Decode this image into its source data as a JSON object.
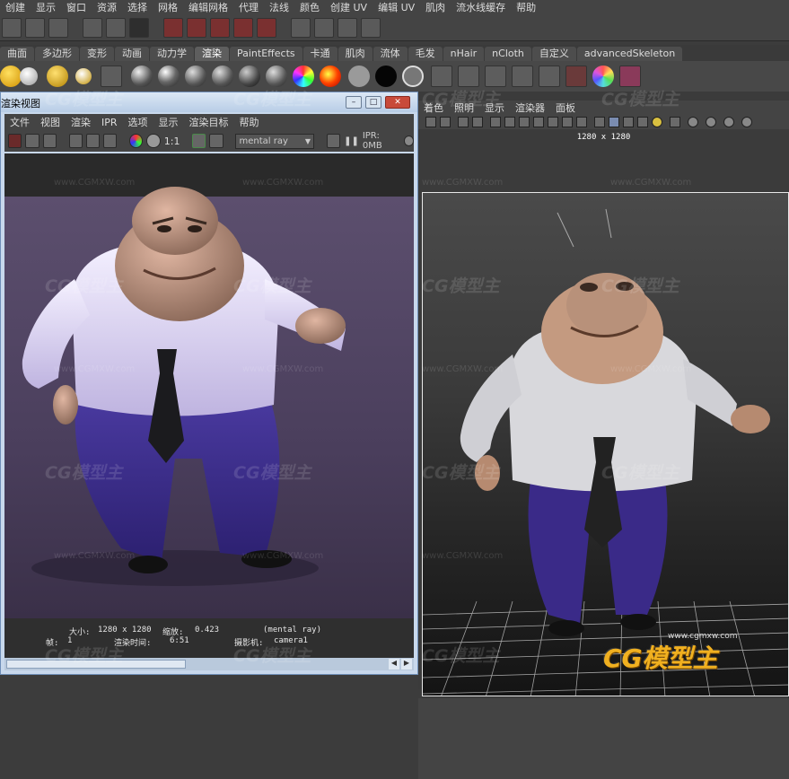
{
  "main_menu": [
    "创建",
    "显示",
    "窗口",
    "资源",
    "选择",
    "网格",
    "编辑网格",
    "代理",
    "法线",
    "颜色",
    "创建 UV",
    "编辑 UV",
    "肌肉",
    "流水线缓存",
    "帮助"
  ],
  "shelf_tabs": [
    "曲面",
    "多边形",
    "变形",
    "动画",
    "动力学",
    "渲染",
    "PaintEffects",
    "卡通",
    "肌肉",
    "流体",
    "毛发",
    "nHair",
    "nCloth",
    "自定义",
    "advancedSkeleton"
  ],
  "shelf_active_tab": "渲染",
  "render_view": {
    "title": "渲染视图",
    "menu": [
      "文件",
      "视图",
      "渲染",
      "IPR",
      "选项",
      "显示",
      "渲染目标",
      "帮助"
    ],
    "ratio_label": "1:1",
    "renderer": "mental ray",
    "ipr_memory": "IPR: 0MB",
    "status_line1": {
      "size_label": "大小:",
      "size": "1280 x 1280",
      "zoom_label": "缩放:",
      "zoom": "0.423",
      "renderer": "(mental ray)"
    },
    "status_line2": {
      "frame_label": "帧:",
      "frame": "1",
      "time_label": "渲染时间:",
      "time": "6:51",
      "camera_label": "摄影机:",
      "camera": "camera1"
    }
  },
  "viewport_panel": {
    "menu": [
      "着色",
      "照明",
      "显示",
      "渲染器",
      "面板"
    ],
    "resolution": "1280 x 1280"
  },
  "watermark": {
    "brand": "CG模型主",
    "url": "www.CGMXW.com"
  },
  "logo": {
    "text": "CG模型主",
    "url": "www.cgmxw.com"
  },
  "colors": {
    "shirt": "#d8d0f0",
    "pants": "#3a2a8a",
    "skin": "#c49a80",
    "tie": "#1a1a1a",
    "ui_bg": "#444444"
  }
}
